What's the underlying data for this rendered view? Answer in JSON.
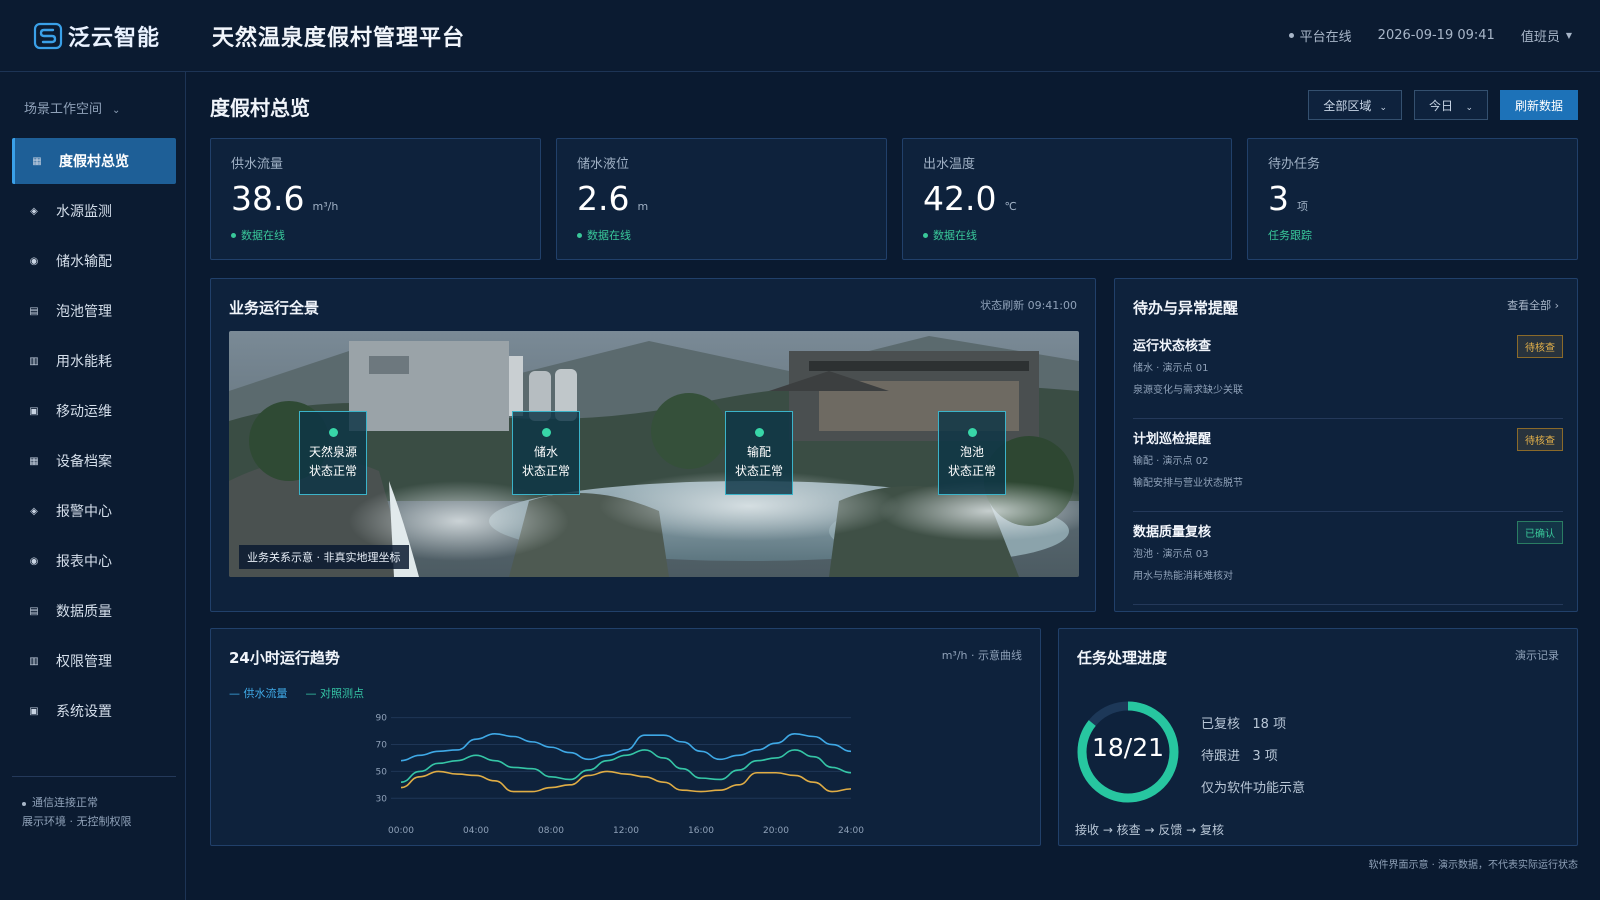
{
  "brand": {
    "name_a": "泛云",
    "name_b": "智能"
  },
  "app_title": "天然温泉度假村管理平台",
  "header": {
    "status": "平台在线",
    "datetime": "2026-09-19 09:41",
    "user": "值班员"
  },
  "sidebar": {
    "workspace": "场景工作空间",
    "items": [
      {
        "label": "度假村总览",
        "icon": "grid-icon",
        "active": true
      },
      {
        "label": "水源监测",
        "icon": "diamond-icon"
      },
      {
        "label": "储水输配",
        "icon": "target-icon"
      },
      {
        "label": "泡池管理",
        "icon": "list-icon"
      },
      {
        "label": "用水能耗",
        "icon": "bars-icon"
      },
      {
        "label": "移动运维",
        "icon": "square-icon"
      },
      {
        "label": "设备档案",
        "icon": "grid-icon"
      },
      {
        "label": "报警中心",
        "icon": "diamond-icon"
      },
      {
        "label": "报表中心",
        "icon": "target-icon"
      },
      {
        "label": "数据质量",
        "icon": "list-icon"
      },
      {
        "label": "权限管理",
        "icon": "bars-icon"
      },
      {
        "label": "系统设置",
        "icon": "square-icon"
      }
    ],
    "footer_status": "通信连接正常",
    "footer_note": "展示环境 · 无控制权限"
  },
  "page": {
    "title": "度假村总览"
  },
  "toolbar": {
    "region": "全部区域",
    "period": "今日",
    "refresh": "刷新数据"
  },
  "kpis": [
    {
      "label": "供水流量",
      "value": "38.6",
      "unit": "m³/h",
      "status": "数据在线"
    },
    {
      "label": "储水液位",
      "value": "2.6",
      "unit": "m",
      "status": "数据在线"
    },
    {
      "label": "出水温度",
      "value": "42.0",
      "unit": "℃",
      "status": "数据在线"
    },
    {
      "label": "待办任务",
      "value": "3",
      "unit": "项",
      "status": "任务跟踪"
    }
  ],
  "overview": {
    "title": "业务运行全景",
    "meta": "状态刷新 09:41:00",
    "caption": "业务关系示意 · 非真实地理坐标",
    "nodes": [
      {
        "name": "天然泉源",
        "state": "状态正常"
      },
      {
        "name": "储水",
        "state": "状态正常"
      },
      {
        "name": "输配",
        "state": "状态正常"
      },
      {
        "name": "泡池",
        "state": "状态正常"
      }
    ]
  },
  "alerts": {
    "title": "待办与异常提醒",
    "link": "查看全部 ›",
    "items": [
      {
        "title": "运行状态核查",
        "sub": "储水 · 演示点 01",
        "desc": "泉源变化与需求缺少关联",
        "badge": "待核查",
        "kind": "warn"
      },
      {
        "title": "计划巡检提醒",
        "sub": "输配 · 演示点 02",
        "desc": "输配安排与营业状态脱节",
        "badge": "待核查",
        "kind": "warn"
      },
      {
        "title": "数据质量复核",
        "sub": "泡池 · 演示点 03",
        "desc": "用水与热能消耗难核对",
        "badge": "已确认",
        "kind": "ok"
      }
    ]
  },
  "trend": {
    "title": "24小时运行趋势",
    "meta": "m³/h · 示意曲线",
    "legend": [
      "— 供水流量",
      "— 对照测点"
    ]
  },
  "chart_data": {
    "type": "line",
    "x": [
      "00:00",
      "01:00",
      "02:00",
      "03:00",
      "04:00",
      "05:00",
      "06:00",
      "07:00",
      "08:00",
      "09:00",
      "10:00",
      "11:00",
      "12:00",
      "13:00",
      "14:00",
      "15:00",
      "16:00",
      "17:00",
      "18:00",
      "19:00",
      "20:00",
      "21:00",
      "22:00",
      "23:00",
      "24:00"
    ],
    "x_ticks": [
      "00:00",
      "04:00",
      "08:00",
      "12:00",
      "16:00",
      "20:00",
      "24:00"
    ],
    "y_ticks": [
      30,
      50,
      70,
      90
    ],
    "ylim": [
      25,
      92
    ],
    "grid": true,
    "series": [
      {
        "name": "供水流量",
        "color": "#3fa9e6",
        "values": [
          58,
          62,
          65,
          66,
          74,
          78,
          76,
          72,
          68,
          64,
          59,
          62,
          66,
          77,
          77,
          72,
          65,
          59,
          62,
          66,
          71,
          78,
          76,
          70,
          65
        ]
      },
      {
        "name": "对照测点",
        "color": "#35c6a6",
        "values": [
          42,
          50,
          56,
          58,
          62,
          58,
          53,
          52,
          46,
          44,
          51,
          58,
          62,
          66,
          60,
          52,
          45,
          44,
          51,
          58,
          60,
          66,
          61,
          53,
          49
        ]
      },
      {
        "name": "",
        "color": "#e0ad45",
        "values": [
          38,
          46,
          50,
          48,
          47,
          43,
          35,
          35,
          38,
          40,
          47,
          50,
          48,
          46,
          42,
          36,
          35,
          36,
          40,
          49,
          49,
          47,
          42,
          35,
          37
        ]
      }
    ]
  },
  "progress": {
    "title": "任务处理进度",
    "meta": "演示记录",
    "done": 18,
    "total": 21,
    "center_text": "18/21",
    "line1": "已复核   18 项",
    "line2": "待跟进   3 项",
    "line3": "仅为软件功能示意",
    "flow": "接收 → 核查 → 反馈 → 复核",
    "ring_color": "#27c6a0"
  },
  "footnote": "软件界面示意 · 演示数据，不代表实际运行状态"
}
